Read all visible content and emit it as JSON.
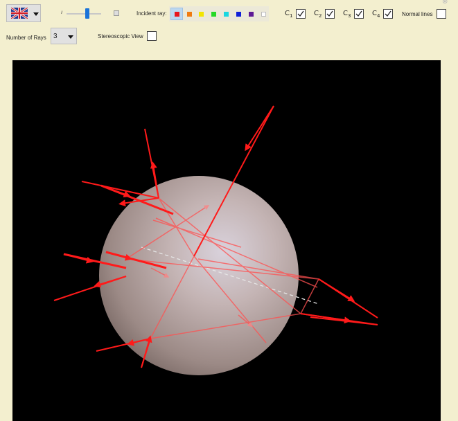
{
  "toolbar": {
    "language_flag": "uk-flag-icon",
    "incident_ray_label": "Incident ray:",
    "incident_ray_colors": [
      "#e8141b",
      "#f07b10",
      "#f2e500",
      "#26d926",
      "#1ad7e0",
      "#1020d8",
      "#5e1a96",
      "#ffffff"
    ],
    "incident_ray_selected_index": 0,
    "slider_value": 0.55,
    "checkboxes": [
      {
        "label": "C",
        "sub": "1",
        "checked": true
      },
      {
        "label": "C",
        "sub": "2",
        "checked": true
      },
      {
        "label": "C",
        "sub": "3",
        "checked": true
      },
      {
        "label": "C",
        "sub": "4",
        "checked": true
      }
    ],
    "normal_lines_label": "Normal lines",
    "normal_lines_checked": false,
    "number_of_rays_label": "Number of Rays",
    "number_of_rays_value": "3",
    "stereoscopic_label": "Stereoscopic View",
    "stereoscopic_checked": false
  },
  "scene": {
    "background": "#000000",
    "sphere_color": "#c8b7b5",
    "ray_color": "#ff1a1a"
  }
}
